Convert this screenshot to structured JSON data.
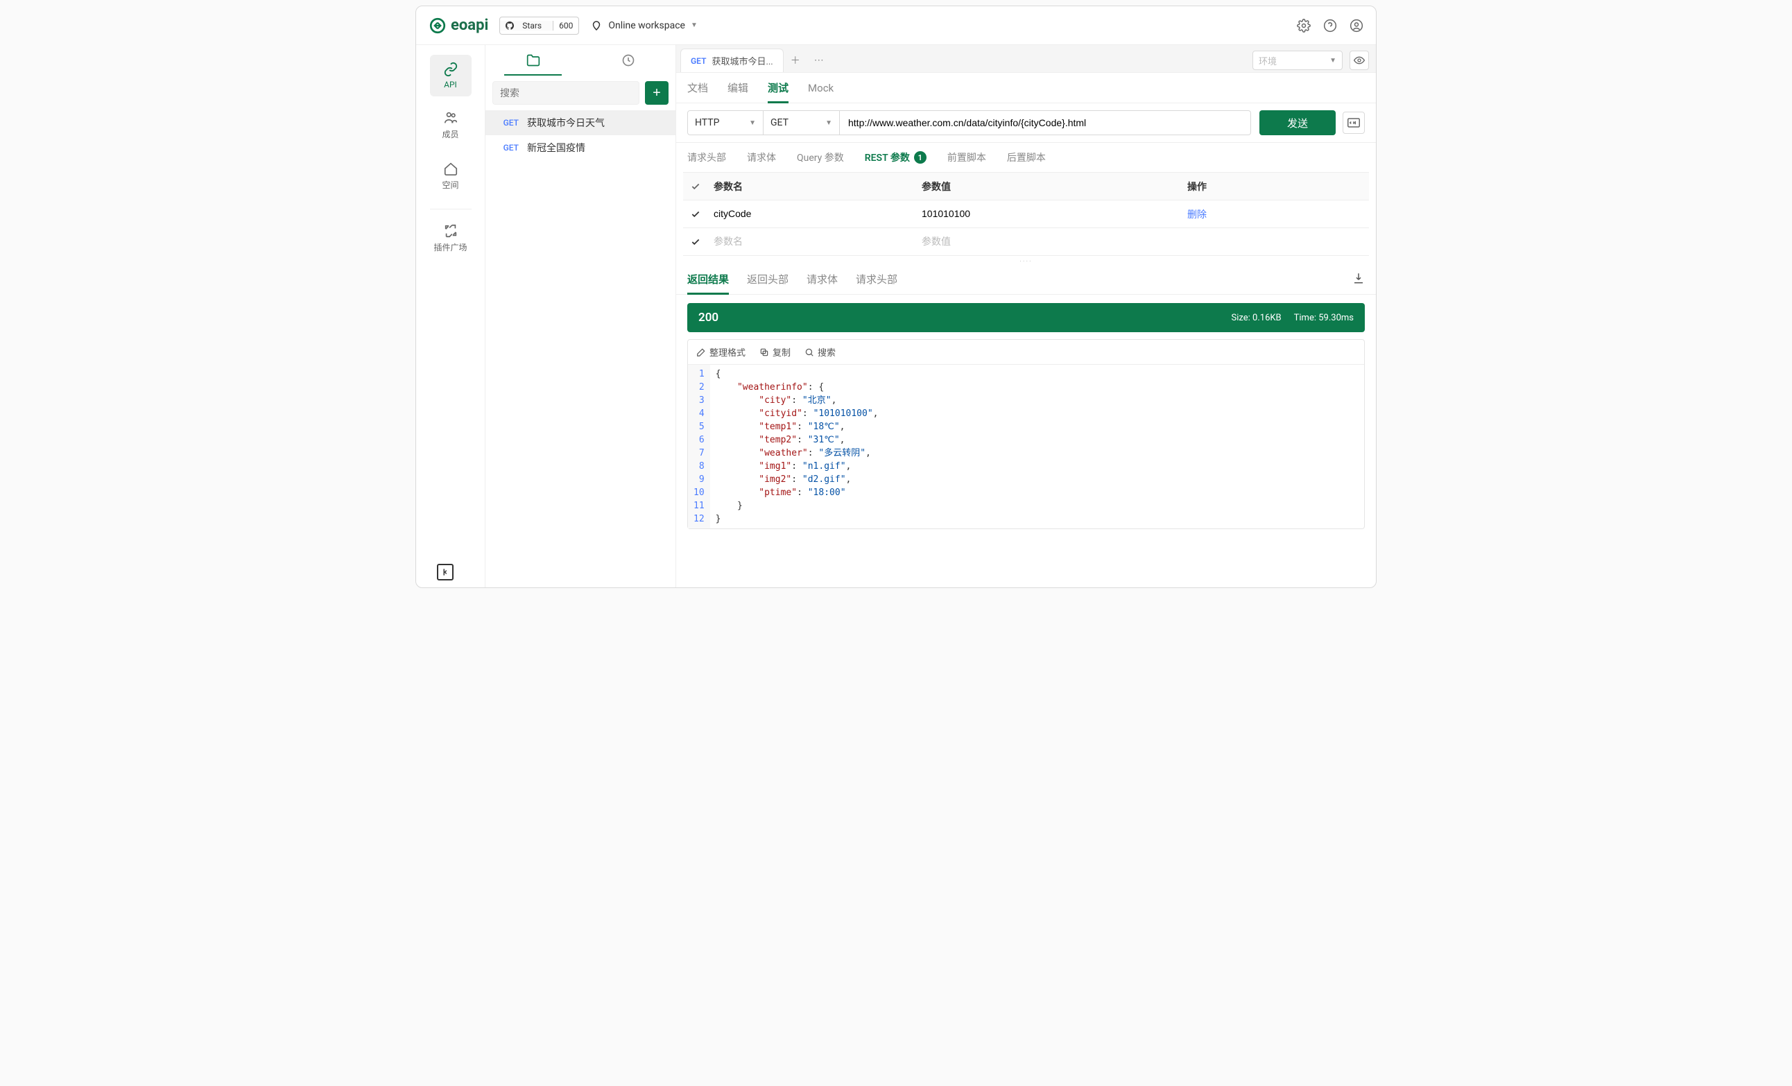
{
  "topbar": {
    "brand": "eoapi",
    "gh_stars_label": "Stars",
    "gh_stars_count": "600",
    "workspace_label": "Online workspace"
  },
  "rail": {
    "api": "API",
    "member": "成员",
    "space": "空间",
    "plugin": "插件广场"
  },
  "sidebar": {
    "search_placeholder": "搜索",
    "items": [
      {
        "method": "GET",
        "label": "获取城市今日天气"
      },
      {
        "method": "GET",
        "label": "新冠全国疫情"
      }
    ]
  },
  "tabbar": {
    "active_method": "GET",
    "active_label": "获取城市今日...",
    "env_placeholder": "环境"
  },
  "subtabs": {
    "doc": "文档",
    "edit": "编辑",
    "test": "测试",
    "mock": "Mock"
  },
  "request": {
    "protocol": "HTTP",
    "method": "GET",
    "url": "http://www.weather.com.cn/data/cityinfo/{cityCode}.html",
    "send": "发送"
  },
  "paramtabs": {
    "header": "请求头部",
    "body": "请求体",
    "query": "Query 参数",
    "rest": "REST 参数",
    "rest_badge": "1",
    "pre": "前置脚本",
    "post": "后置脚本"
  },
  "table": {
    "col_name": "参数名",
    "col_value": "参数值",
    "col_op": "操作",
    "rows": [
      {
        "name": "cityCode",
        "value": "101010100",
        "op": "删除"
      }
    ],
    "placeholder_name": "参数名",
    "placeholder_value": "参数值"
  },
  "restabs": {
    "result": "返回结果",
    "res_header": "返回头部",
    "req_body": "请求体",
    "req_header": "请求头部"
  },
  "status": {
    "code": "200",
    "size_label": "Size: 0.16KB",
    "time_label": "Time: 59.30ms"
  },
  "code_toolbar": {
    "format": "整理格式",
    "copy": "复制",
    "search": "搜索"
  },
  "response_json": {
    "weatherinfo": {
      "city": "北京",
      "cityid": "101010100",
      "temp1": "18℃",
      "temp2": "31℃",
      "weather": "多云转阴",
      "img1": "n1.gif",
      "img2": "d2.gif",
      "ptime": "18:00"
    }
  }
}
